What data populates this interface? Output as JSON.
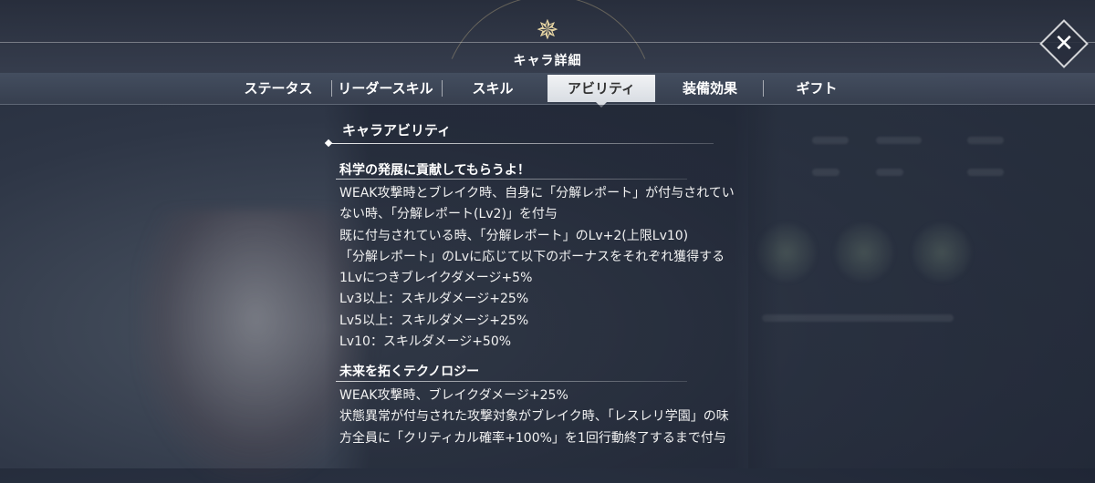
{
  "header": {
    "title": "キャラ詳細",
    "emblem_icon": "compass-star-icon",
    "close_icon": "close-icon"
  },
  "tabs": [
    {
      "label": "ステータス",
      "active": false
    },
    {
      "label": "リーダースキル",
      "active": false
    },
    {
      "label": "スキル",
      "active": false
    },
    {
      "label": "アビリティ",
      "active": true
    },
    {
      "label": "装備効果",
      "active": false
    },
    {
      "label": "ギフト",
      "active": false
    }
  ],
  "main": {
    "section_title": "キャラアビリティ",
    "abilities": [
      {
        "name": "科学の発展に貢献してもらうよ！",
        "lines": [
          "WEAK攻撃時とブレイク時、自身に「分解レポート」が付与されてい",
          "ない時、「分解レポート(Lv2)」を付与",
          "既に付与されている時、「分解レポート」のLv+2(上限Lv10)",
          "「分解レポート」のLvに応じて以下のボーナスをそれぞれ獲得する",
          "1Lvにつきブレイクダメージ+5%",
          "Lv3以上：スキルダメージ+25%",
          "Lv5以上：スキルダメージ+25%",
          "Lv10：スキルダメージ+50%"
        ]
      },
      {
        "name": "未来を拓くテクノロジー",
        "lines": [
          "WEAK攻撃時、ブレイクダメージ+25%",
          "状態異常が付与された攻撃対象がブレイク時、「レスレリ学園」の味",
          "方全員に「クリティカル確率+100%」を1回行動終了するまで付与"
        ]
      }
    ]
  }
}
